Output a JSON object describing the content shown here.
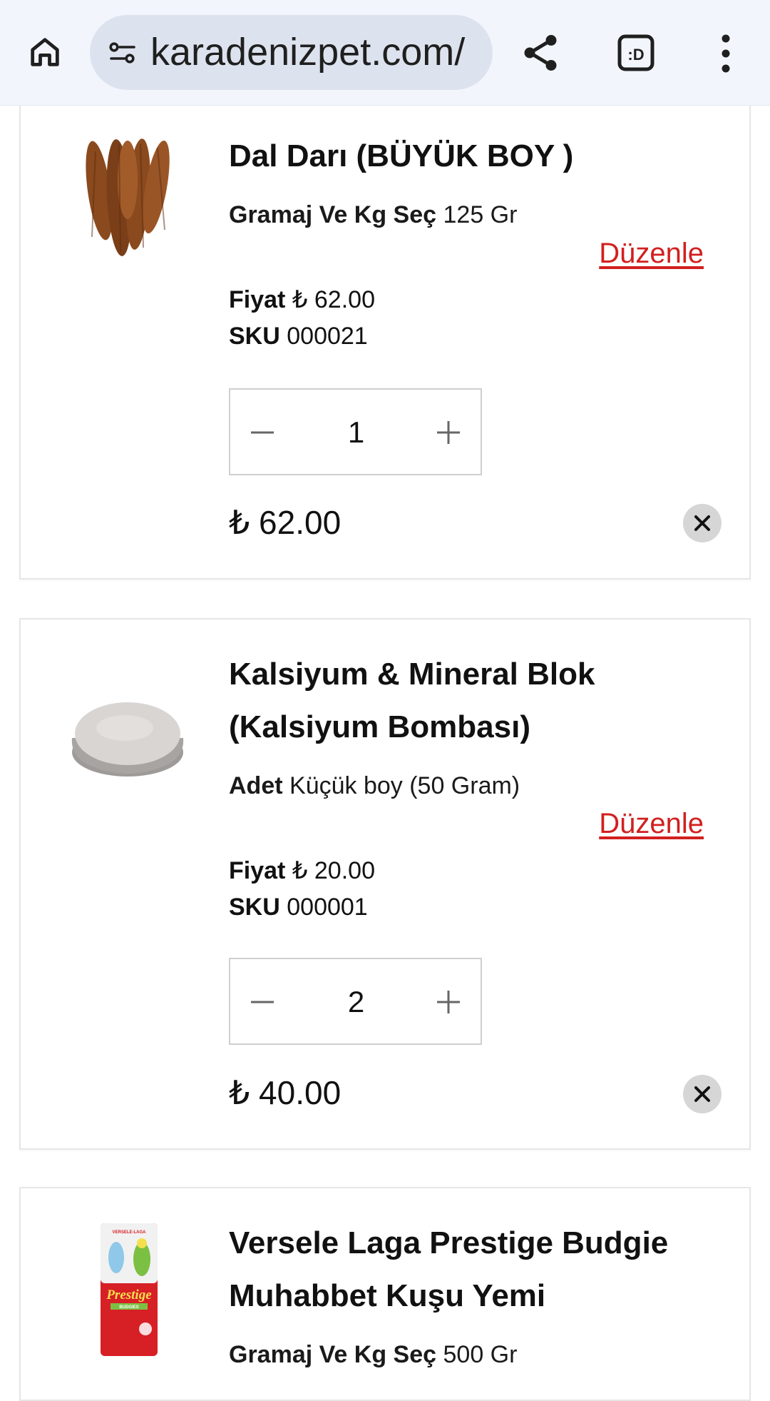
{
  "browser": {
    "url": "karadenizpet.com/",
    "tab_switcher_label": ":D",
    "icons": [
      "home-icon",
      "site-settings-icon",
      "share-icon",
      "tab-switcher-icon",
      "more-vert-icon"
    ]
  },
  "cart": {
    "items": [
      {
        "title": "Dal Darı (BÜYÜK BOY )",
        "option_label": "Gramaj Ve Kg Seç",
        "option_value": "125 Gr",
        "edit_label": "Düzenle",
        "price_label": "Fiyat",
        "price_value": "₺ 62.00",
        "sku_label": "SKU",
        "sku_value": "000021",
        "quantity": "1",
        "line_total": "₺ 62.00"
      },
      {
        "title": "Kalsiyum & Mineral Blok (Kalsiyum Bombası)",
        "option_label": "Adet",
        "option_value": "Küçük boy (50 Gram)",
        "edit_label": "Düzenle",
        "price_label": "Fiyat",
        "price_value": "₺ 20.00",
        "sku_label": "SKU",
        "sku_value": "000001",
        "quantity": "2",
        "line_total": "₺ 40.00"
      },
      {
        "title": "Versele Laga Prestige Budgie Muhabbet Kuşu Yemi",
        "option_label": "Gramaj Ve Kg Seç",
        "option_value": "500 Gr",
        "package_brand": "VERSELE-LAGA",
        "package_name": "Prestige",
        "package_sub": "BUDGIES"
      }
    ]
  },
  "colors": {
    "accent_link": "#d21f1f",
    "topbar_bg": "#f2f6fc",
    "url_pill_bg": "#dde3ee"
  }
}
